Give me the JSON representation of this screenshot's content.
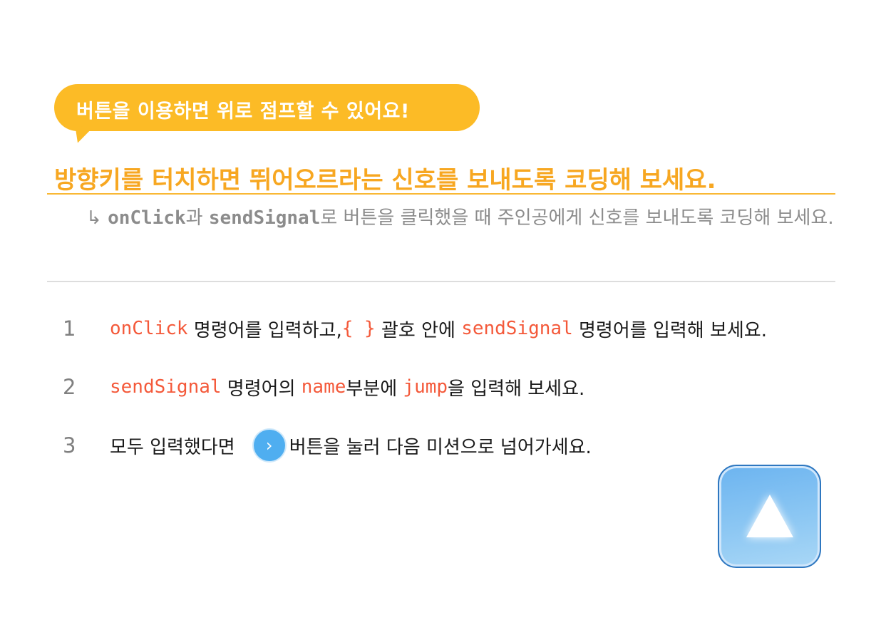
{
  "bubble": {
    "text": "버튼을 이용하면 위로 점프할 수 있어요!"
  },
  "heading": "방향키를 터치하면 뛰어오르라는 신호를 보내도록 코딩해 보세요.",
  "subtitle": {
    "arrow": "↳",
    "code1": "onClick",
    "text1": "과 ",
    "code2": "sendSignal",
    "text2": "로 버튼을 클릭했을 때 주인공에게 신호를 보내도록 코딩해 보세요."
  },
  "steps": [
    {
      "number": "1",
      "parts": [
        "onClick",
        " 명령어를 입력하고,",
        "{ }",
        " 괄호 안에 ",
        "sendSignal",
        " 명령어를 입력해 보세요."
      ]
    },
    {
      "number": "2",
      "parts": [
        "sendSignal",
        " 명령어의 ",
        "name",
        "부분에 ",
        "jump",
        "을 입력해 보세요."
      ]
    },
    {
      "number": "3",
      "parts": [
        "모두 입력했다면",
        "버튼을 눌러 다음 미션으로 넘어가세요."
      ]
    }
  ],
  "icons": {
    "next": "›",
    "jump": "up-triangle"
  },
  "colors": {
    "accent": "#FCBB26",
    "heading": "#F7A721",
    "code": "#F4593A",
    "next_button": "#4FAEF0"
  }
}
